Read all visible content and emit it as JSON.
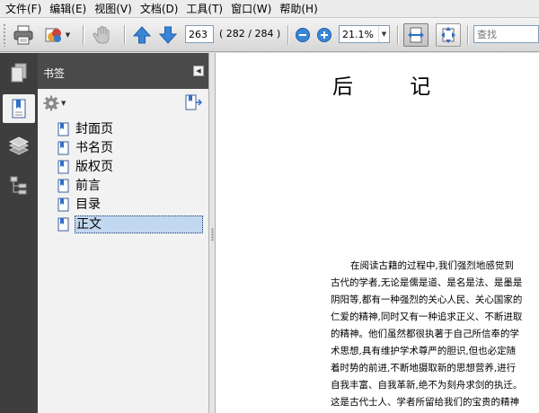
{
  "menu": [
    {
      "label": "文件(F)"
    },
    {
      "label": "编辑(E)"
    },
    {
      "label": "视图(V)"
    },
    {
      "label": "文档(D)"
    },
    {
      "label": "工具(T)"
    },
    {
      "label": "窗口(W)"
    },
    {
      "label": "帮助(H)"
    }
  ],
  "toolbar": {
    "page_number": "263",
    "page_count": "( 282 / 284 )",
    "zoom": "21.1%",
    "search_placeholder": "查找",
    "icons": [
      "printer-icon",
      "share-icon",
      "hand-icon",
      "previous-page-icon",
      "next-page-icon",
      "zoom-out-icon",
      "zoom-in-icon",
      "fit-width-icon",
      "fit-page-icon"
    ]
  },
  "navrail": {
    "icons": [
      "pages-icon",
      "bookmarks-icon",
      "layers-icon",
      "model-tree-icon"
    ],
    "active": "bookmarks-icon"
  },
  "bookmarks": {
    "title": "书签",
    "items": [
      {
        "label": "封面页"
      },
      {
        "label": "书名页"
      },
      {
        "label": "版权页"
      },
      {
        "label": "前言"
      },
      {
        "label": "目录"
      },
      {
        "label": "正文",
        "selected": true
      }
    ]
  },
  "document": {
    "heading": "后 记",
    "lines": [
      "在阅读古籍的过程中,我们强烈地感觉到",
      "古代的学者,无论是儒是道、是名是法、是墨是",
      "阴阳等,都有一种强烈的关心人民、关心国家的",
      "仁爱的精神,同时又有一种追求正义、不断进取",
      "的精神。他们虽然都很执著于自己所信奉的学",
      "术思想,具有维护学术尊严的胆识,但也必定随",
      "着时势的前进,不断地摄取新的思想营养,进行",
      "自我丰富、自我革新,绝不为刻舟求剑的执迁。",
      "这是古代士人、学者所留给我们的宝贵的精神"
    ]
  },
  "colors": {
    "rail_bg": "#3e3e3e",
    "panel_header_bg": "#4a4a4a",
    "selection": "#c2d7f0",
    "accent_blue": "#2f6fc8"
  }
}
